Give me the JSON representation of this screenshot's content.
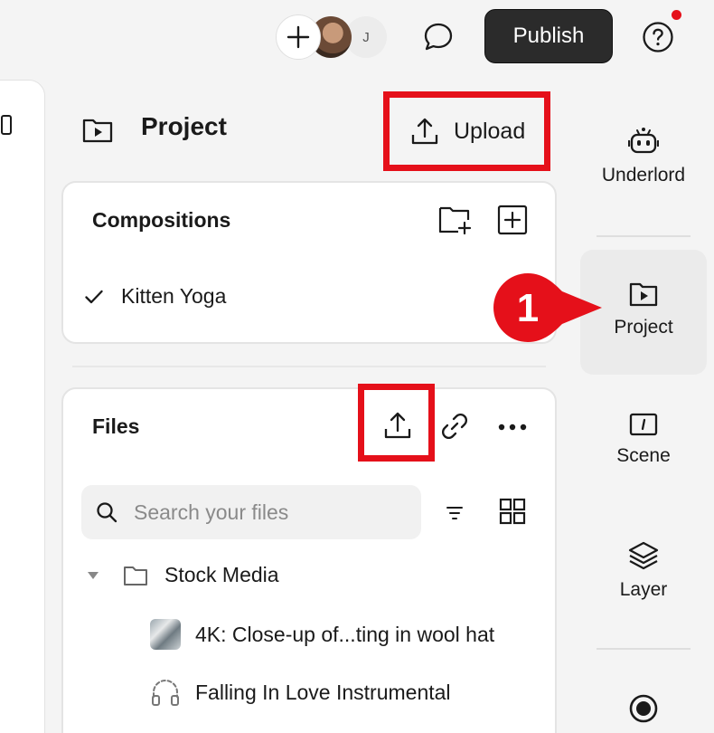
{
  "topbar": {
    "avatar_initial": "J",
    "publish_label": "Publish"
  },
  "project": {
    "title": "Project",
    "upload_label": "Upload"
  },
  "compositions": {
    "title": "Compositions",
    "items": [
      {
        "label": "Kitten Yoga",
        "selected": true
      }
    ]
  },
  "files": {
    "title": "Files",
    "search_placeholder": "Search your files",
    "tree": [
      {
        "label": "Stock Media",
        "type": "folder",
        "expanded": true
      },
      {
        "label": "4K: Close-up of...ting in wool hat",
        "type": "video"
      },
      {
        "label": "Falling In Love Instrumental",
        "type": "audio"
      }
    ]
  },
  "right_nav": {
    "items": [
      {
        "label": "Underlord",
        "icon": "robot-icon"
      },
      {
        "label": "Project",
        "icon": "folder-play-icon",
        "active": true
      },
      {
        "label": "Scene",
        "icon": "scene-icon"
      },
      {
        "label": "Layer",
        "icon": "layers-icon"
      },
      {
        "label": "",
        "icon": "record-icon"
      }
    ]
  },
  "callout": {
    "number": "1"
  },
  "colors": {
    "highlight": "#e5101a",
    "publish_bg": "#2b2b2b",
    "active_nav_bg": "#ebebeb"
  }
}
